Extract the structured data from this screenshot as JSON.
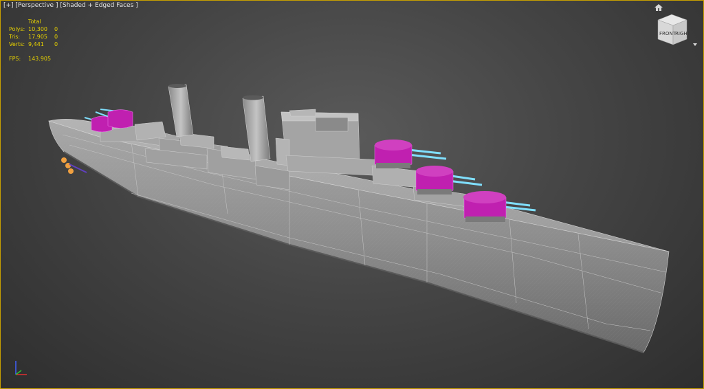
{
  "viewport": {
    "label_plus": "[+]",
    "label_view": "[Perspective ]",
    "label_shading": "[Shaded + Edged Faces ]"
  },
  "stats": {
    "header": "Total",
    "rows": [
      {
        "label": "Polys:",
        "total": "10,300",
        "selected": "0"
      },
      {
        "label": "Tris:",
        "total": "17,905",
        "selected": "0"
      },
      {
        "label": "Verts:",
        "total": "9,441",
        "selected": "0"
      }
    ],
    "fps_label": "FPS:",
    "fps_value": "143.905"
  },
  "viewcube": {
    "front_label": "FRONT",
    "right_label": "RIGHT"
  },
  "icons": {
    "home": "home-icon",
    "viewcube_menu": "viewcube-menu-icon",
    "axis": "axis-tripod-icon"
  },
  "colors": {
    "border": "#c8a000",
    "stats_text": "#e8d200",
    "hull": "#9a9a9a",
    "turret": "#c020b0",
    "barrel": "#80e0ff"
  }
}
